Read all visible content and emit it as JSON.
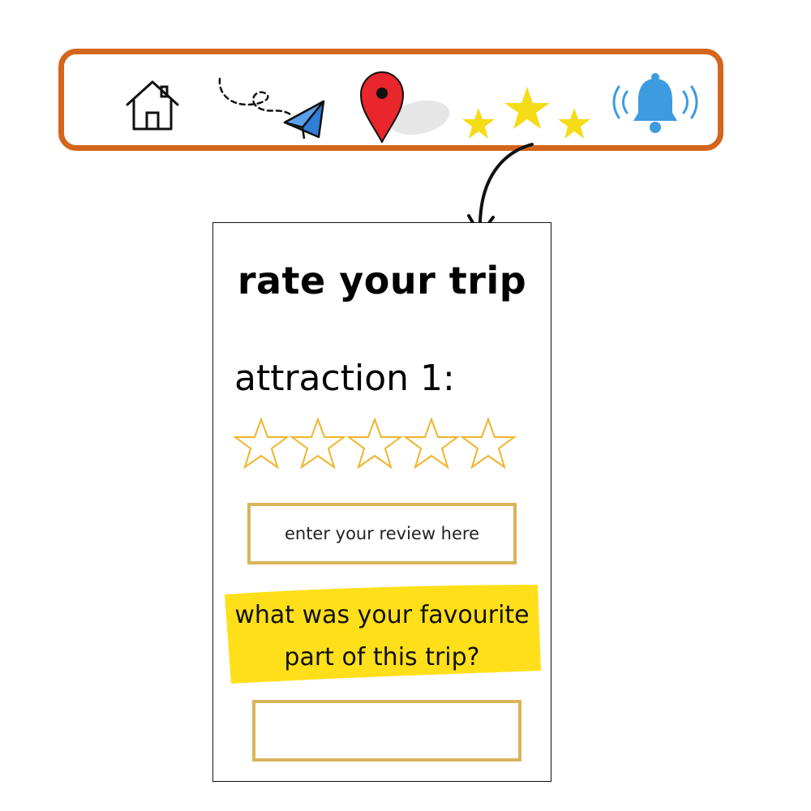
{
  "colors": {
    "nav_border": "#d4651b",
    "star_gold": "#f5c518",
    "rating_outline": "#f0b429",
    "pin_red": "#e8262b",
    "bell_blue": "#3d9be0",
    "plane_blue": "#2f7fd8",
    "box_gold": "#d9b45a",
    "highlight_yellow": "#ffdf1a"
  },
  "nav": {
    "items": [
      {
        "icon": "home-icon"
      },
      {
        "icon": "paper-plane-icon"
      },
      {
        "icon": "map-pin-icon"
      },
      {
        "icon": "stars-icon"
      },
      {
        "icon": "bell-icon"
      }
    ]
  },
  "screen": {
    "title": "rate your trip",
    "attraction_label": "attraction 1:",
    "rating": {
      "max": 5,
      "value": 0
    },
    "review_placeholder": "enter your review here",
    "question_line1": "what was your favourite",
    "question_line2": "part of this trip?",
    "answer_value": ""
  }
}
